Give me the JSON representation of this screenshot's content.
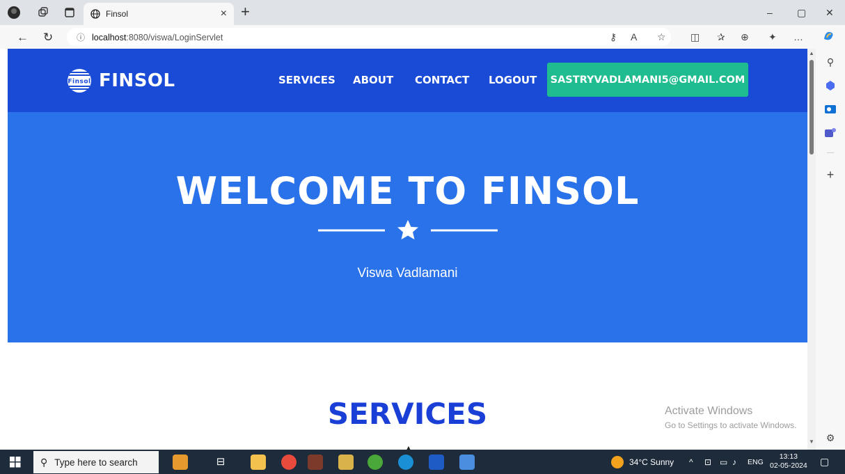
{
  "browser": {
    "tab_title": "Finsol",
    "tab_close": "×",
    "new_tab": "+",
    "url_host": "localhost",
    "url_path": ":8080/viswa/LoginServlet",
    "window_controls": [
      "–",
      "▢",
      "✕"
    ]
  },
  "site": {
    "brand": "FINSOL",
    "logo_text": "Finsol",
    "nav": [
      "SERVICES",
      "ABOUT",
      "CONTACT",
      "LOGOUT"
    ],
    "email": "SASTRYVADLAMANI5@GMAIL.COM",
    "hero_title": "WELCOME TO FINSOL",
    "hero_subtitle": "Viswa Vadlamani",
    "section_title": "SERVICES"
  },
  "watermark": {
    "line1": "Activate Windows",
    "line2": "Go to Settings to activate Windows."
  },
  "taskbar": {
    "search_placeholder": "Type here to search",
    "weather": "34°C  Sunny",
    "lang": "ENG",
    "time": "13:13",
    "date": "02-05-2024"
  },
  "colors": {
    "nav_bg": "#1a4bd6",
    "hero_bg": "#2a72e9",
    "email_btn": "#1ebc8e",
    "services_heading": "#1a3fd6"
  }
}
